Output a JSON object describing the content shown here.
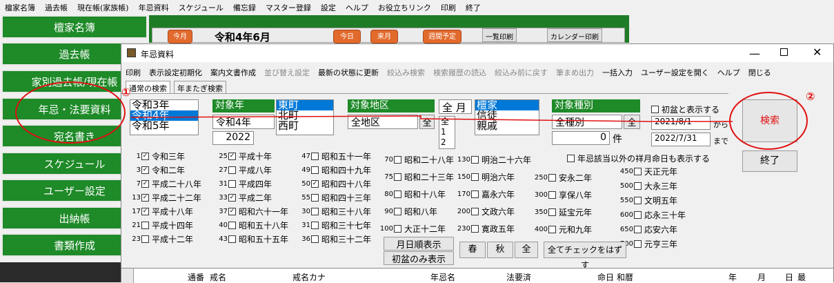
{
  "main_menu": [
    "檀家名簿",
    "過去帳",
    "現在帳(家族帳)",
    "年忌資料",
    "スケジュール",
    "備忘録",
    "マスター登録",
    "設定",
    "ヘルプ",
    "お役立ちリンク",
    "印刷",
    "終了"
  ],
  "nav": [
    "檀家名簿",
    "過去帳",
    "家別過去帳/現在帳",
    "年忌・法要資料",
    "宛名書き",
    "スケジュール",
    "ユーザー設定",
    "出納帳",
    "書類作成"
  ],
  "calendar": {
    "month_title": "令和4年6月",
    "btn_prev": "今月",
    "btn_a": "今日",
    "btn_b": "来月",
    "btn_c": "週間予定",
    "btn_print": "一覧印刷",
    "btn_cal_print": "カレンダー印刷"
  },
  "dialog": {
    "title": "年忌資料",
    "menu": [
      {
        "label": "印刷",
        "enabled": true
      },
      {
        "label": "表示設定初期化",
        "enabled": true
      },
      {
        "label": "案内文書作成",
        "enabled": true
      },
      {
        "label": "並び替え設定",
        "enabled": false
      },
      {
        "label": "最新の状態に更新",
        "enabled": true
      },
      {
        "label": "絞込み検索",
        "enabled": false
      },
      {
        "label": "検索履歴の読込",
        "enabled": false
      },
      {
        "label": "絞込み前に戻す",
        "enabled": false
      },
      {
        "label": "筆まめ出力",
        "enabled": false
      },
      {
        "label": "一括入力",
        "enabled": true
      },
      {
        "label": "ユーザー設定を開く",
        "enabled": true
      },
      {
        "label": "ヘルプ",
        "enabled": true
      },
      {
        "label": "閉じる",
        "enabled": true
      }
    ],
    "tabs": [
      "通常の検索",
      "年またぎ検索"
    ],
    "year_list": [
      "令和3年",
      "令和4年",
      "令和5年"
    ],
    "year_selected": 1,
    "target_year_head": "対象年",
    "target_year_value": "令和4年",
    "target_year_num": "2022",
    "area_list": [
      "東町",
      "北町",
      "西町"
    ],
    "area_head": "対象地区",
    "area_value": "全地区",
    "area_all": "全",
    "month_all": "全",
    "month_label": "月",
    "month_list": [
      "全",
      "1",
      "2"
    ],
    "type_list": [
      "檀家",
      "信徒",
      "親戚"
    ],
    "type_head": "対象種別",
    "type_value": "全種別",
    "type_all": "全",
    "count_value": "0",
    "count_unit": "件",
    "first_bon_label": "初盆と表示する",
    "date_from": "2021/8/1",
    "from_label": "から",
    "date_to": "2022/7/31",
    "to_label": "まで",
    "search_label": "検索",
    "end_label": "終了",
    "show_monthly_label": "年忌該当以外の祥月命日も表示する",
    "btn_month_order": "月日順表示",
    "btn_first_bon_only": "初盆のみ表示",
    "btn_spring": "春",
    "btn_autumn": "秋",
    "btn_all": "全",
    "btn_uncheck_all": "全てチェックをはずす",
    "annot_1": "①",
    "annot_2": "②",
    "grid_headers": [
      "通番",
      "戒名",
      "戒名カナ",
      "年忌名",
      "法要済",
      "命日",
      "和暦",
      "年",
      "月",
      "日",
      "最"
    ],
    "check_columns": [
      [
        {
          "num": "1",
          "label": "令和三年",
          "checked": true
        },
        {
          "num": "3",
          "label": "令和二年",
          "checked": true
        },
        {
          "num": "7",
          "label": "平成二十八年",
          "checked": true
        },
        {
          "num": "13",
          "label": "平成二十二年",
          "checked": true
        },
        {
          "num": "17",
          "label": "平成十八年",
          "checked": true
        },
        {
          "num": "21",
          "label": "平成十四年",
          "checked": false
        },
        {
          "num": "23",
          "label": "平成十二年",
          "checked": false
        }
      ],
      [
        {
          "num": "25",
          "label": "平成十年",
          "checked": true
        },
        {
          "num": "27",
          "label": "平成八年",
          "checked": false
        },
        {
          "num": "31",
          "label": "平成四年",
          "checked": false
        },
        {
          "num": "33",
          "label": "平成二年",
          "checked": true
        },
        {
          "num": "37",
          "label": "昭和六十一年",
          "checked": true
        },
        {
          "num": "40",
          "label": "昭和五十八年",
          "checked": false
        },
        {
          "num": "43",
          "label": "昭和五十五年",
          "checked": false
        }
      ],
      [
        {
          "num": "47",
          "label": "昭和五十一年",
          "checked": false
        },
        {
          "num": "49",
          "label": "昭和四十九年",
          "checked": false
        },
        {
          "num": "50",
          "label": "昭和四十八年",
          "checked": true
        },
        {
          "num": "55",
          "label": "昭和四十三年",
          "checked": false
        },
        {
          "num": "30",
          "label": "昭和三十八年",
          "checked": false
        },
        {
          "num": "31",
          "label": "昭和三十七年",
          "checked": false
        },
        {
          "num": "36",
          "label": "昭和三十二年",
          "checked": false
        }
      ],
      [
        {
          "num": "70",
          "label": "昭和二十八年",
          "checked": false
        },
        {
          "num": "75",
          "label": "昭和二十三年",
          "checked": false
        },
        {
          "num": "80",
          "label": "昭和十八年",
          "checked": false
        },
        {
          "num": "90",
          "label": "昭和八年",
          "checked": false
        },
        {
          "num": "100",
          "label": "大正十二年",
          "checked": false
        }
      ],
      [
        {
          "num": "130",
          "label": "明治二十六年",
          "checked": false
        },
        {
          "num": "150",
          "label": "明治六年",
          "checked": false
        },
        {
          "num": "170",
          "label": "嘉永六年",
          "checked": false
        },
        {
          "num": "200",
          "label": "文政六年",
          "checked": false
        },
        {
          "num": "230",
          "label": "寛政五年",
          "checked": false
        }
      ],
      [
        {
          "num": "250",
          "label": "安永二年",
          "checked": false
        },
        {
          "num": "300",
          "label": "享保八年",
          "checked": false
        },
        {
          "num": "350",
          "label": "延宝元年",
          "checked": false
        },
        {
          "num": "400",
          "label": "元和九年",
          "checked": false
        }
      ],
      [
        {
          "num": "450",
          "label": "天正元年",
          "checked": false
        },
        {
          "num": "500",
          "label": "大永三年",
          "checked": false
        },
        {
          "num": "550",
          "label": "文明五年",
          "checked": false
        },
        {
          "num": "600",
          "label": "応永三十年",
          "checked": false
        },
        {
          "num": "650",
          "label": "応安六年",
          "checked": false
        },
        {
          "num": "700",
          "label": "元亨三年",
          "checked": false
        }
      ]
    ]
  }
}
